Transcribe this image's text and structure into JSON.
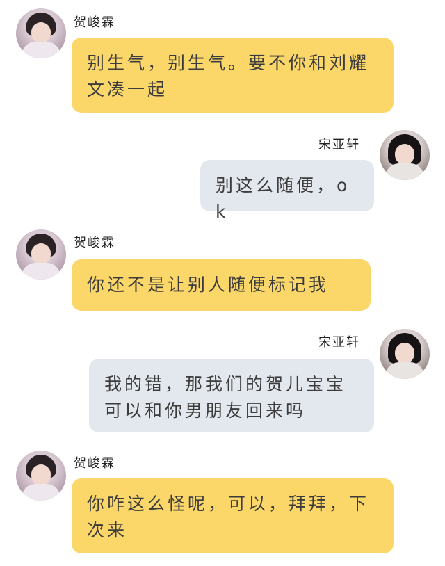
{
  "chat": {
    "messages": [
      {
        "sender": "贺峻霖",
        "side": "left",
        "avatar_icon": "avatar-he-junlin",
        "text": "别生气，别生气。要不你和刘耀文凑一起"
      },
      {
        "sender": "宋亚轩",
        "side": "right",
        "avatar_icon": "avatar-song-yaxuan",
        "text": "别这么随便，ok"
      },
      {
        "sender": "贺峻霖",
        "side": "left",
        "avatar_icon": "avatar-he-junlin",
        "text": "你还不是让别人随便标记我"
      },
      {
        "sender": "宋亚轩",
        "side": "right",
        "avatar_icon": "avatar-song-yaxuan",
        "text": "我的错，那我们的贺儿宝宝可以和你男朋友回来吗"
      },
      {
        "sender": "贺峻霖",
        "side": "left",
        "avatar_icon": "avatar-he-junlin",
        "text": "你咋这么怪呢，可以，拜拜，下次来"
      }
    ]
  },
  "colors": {
    "left_bubble": "#fbd769",
    "right_bubble": "#e3e7ee",
    "text": "#3c3c3c",
    "background": "#ffffff"
  }
}
